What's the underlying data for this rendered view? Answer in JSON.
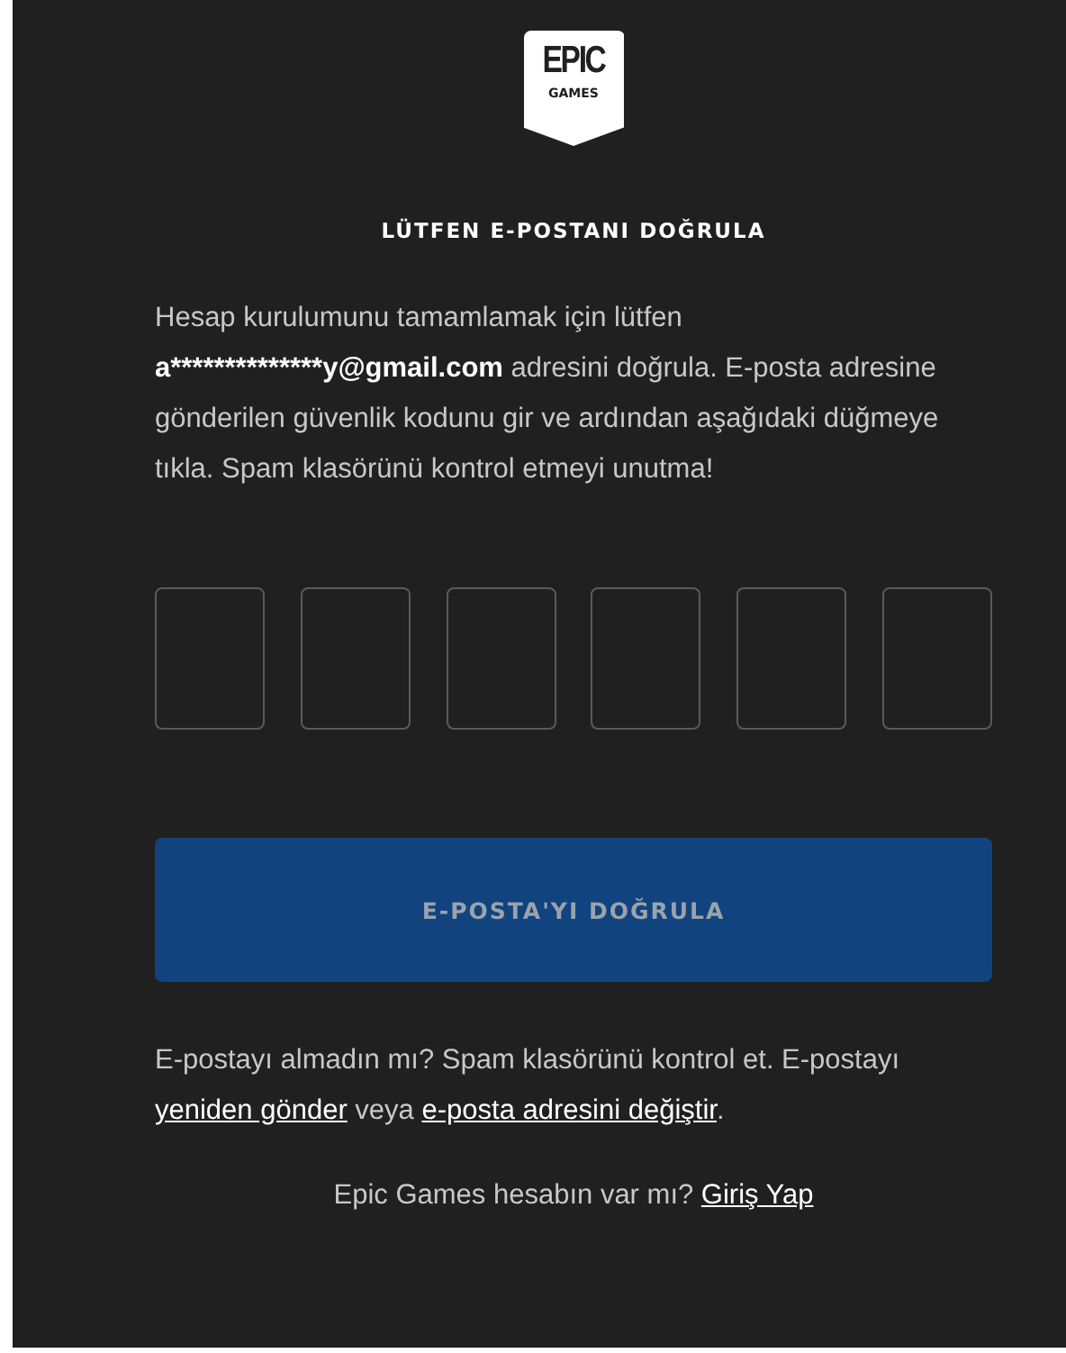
{
  "logo": {
    "line_1": "EPIC",
    "line_2": "GAMES"
  },
  "title": "LÜTFEN E-POSTANI DOĞRULA",
  "intro": [
    {
      "text": "Hesap kurulumunu tamamlamak için lütfen ",
      "bold": false
    },
    {
      "text": "a**************y@gmail.com",
      "bold": true
    },
    {
      "text": " adresini doğrula. E-posta adresine gönderilen güvenlik kodunu gir ve ardından aşağıdaki düğmeye tıkla. Spam klasörünü kontrol etmeyi unutma!",
      "bold": false
    }
  ],
  "verify_button": {
    "label": "E-POSTA'YI DOĞRULA",
    "disabled": true
  },
  "help_text": [
    {
      "text": "E-postayı almadın mı? Spam klasörünü kontrol et. E-postayı ",
      "link": false
    },
    {
      "text": "yeniden gönder",
      "link": true
    },
    {
      "text": " veya ",
      "link": false
    },
    {
      "text": "e-posta adresini değiştir",
      "link": true
    },
    {
      "text": ".",
      "link": false
    }
  ],
  "footer": [
    {
      "text": "Epic Games hesabın var mı? ",
      "link": false
    },
    {
      "text": "Giriş Yap",
      "link": true
    }
  ]
}
